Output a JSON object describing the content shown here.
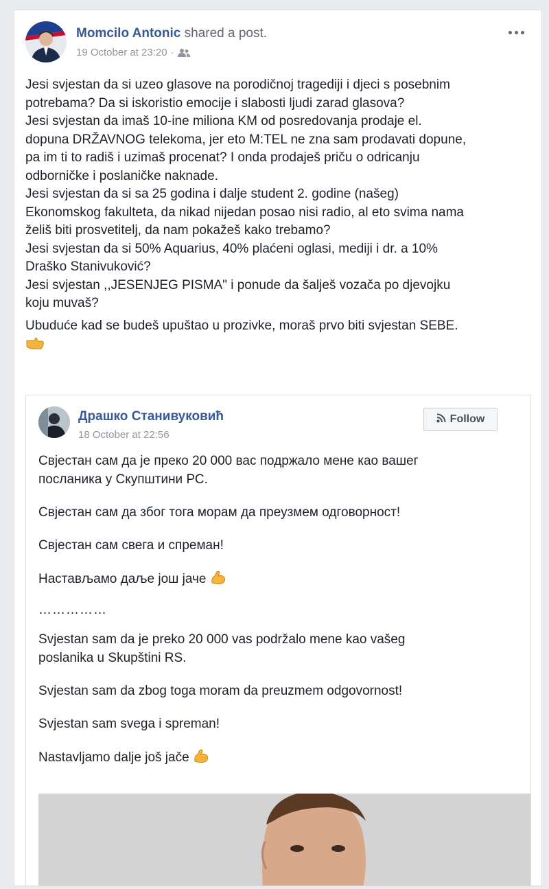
{
  "post": {
    "author": "Momcilo Antonic",
    "action": "shared a post.",
    "timestamp": "19 October at 23:20",
    "separator": "·",
    "audience_icon": "friends-icon",
    "menu_icon": "more-options-icon",
    "text_lines": [
      "Jesi svjestan da si uzeo glasove na porodičnoj tragediji i djeci s posebnim",
      "potrebama? Da si iskoristio emocije i slabosti ljudi zarad glasova?",
      "Jesi svjestan da imaš 10-ine miliona KM od posredovanja prodaje el.",
      "dopuna DRŽAVNOG telekoma, jer eto M:TEL ne zna sam prodavati dopune,",
      "pa im ti to radiš i uzimaš procenat? I onda prodaješ priču o odricanju",
      "odborničke i poslaničke naknade.",
      "Jesi svjestan da si sa 25 godina i dalje student 2. godine (našeg)",
      "Ekonomskog fakulteta, da nikad nijedan posao nisi radio, al eto svima nama",
      "želiš biti prosvetitelj, da nam pokažeš kako trebamo?",
      "Jesi svjestan da si 50% Aquarius, 40% plaćeni oglasi, mediji i dr. a 10%",
      "Draško Stanivuković?",
      "Jesi svjestan ,,JESENJEG PISMA\" i ponude da šalješ vozača po djevojku",
      "koju muvaš?"
    ],
    "closing_line": "Ubuduće kad se budeš upuštao u prozivke, moraš prvo biti svjestan SEBE.",
    "closing_emoji": "pointing-hand-emoji"
  },
  "shared_post": {
    "author": "Драшко Станивуковић",
    "timestamp": "18 October at 22:56",
    "follow_label": "Follow",
    "follow_icon": "rss-follow-icon",
    "paragraphs_cyr": [
      "Свјестан сам да је преко 20 000 вас подржало мене као вашег",
      "посланика у Скупштини РС.",
      "Свјестан сам да због тога морам да преузмем одговорност!",
      "Свјестан сам свега и спреман!",
      "Настављамо даље још јаче"
    ],
    "separator_dots": "……………",
    "paragraphs_lat": [
      "Svjestan sam da je preko 20 000 vas podržalo mene kao vašeg",
      "poslanika u Skupštini RS.",
      "Svjestan sam da zbog toga moram da preuzmem odgovornost!",
      "Svjestan sam svega i spreman!",
      "Nastavljamo dalje još jače"
    ],
    "emoji": "flexed-biceps-emoji",
    "photo": "portrait-photo"
  },
  "colors": {
    "link": "#385898",
    "meta": "#90949c",
    "text": "#1d2129",
    "background": "#e9ebee"
  }
}
